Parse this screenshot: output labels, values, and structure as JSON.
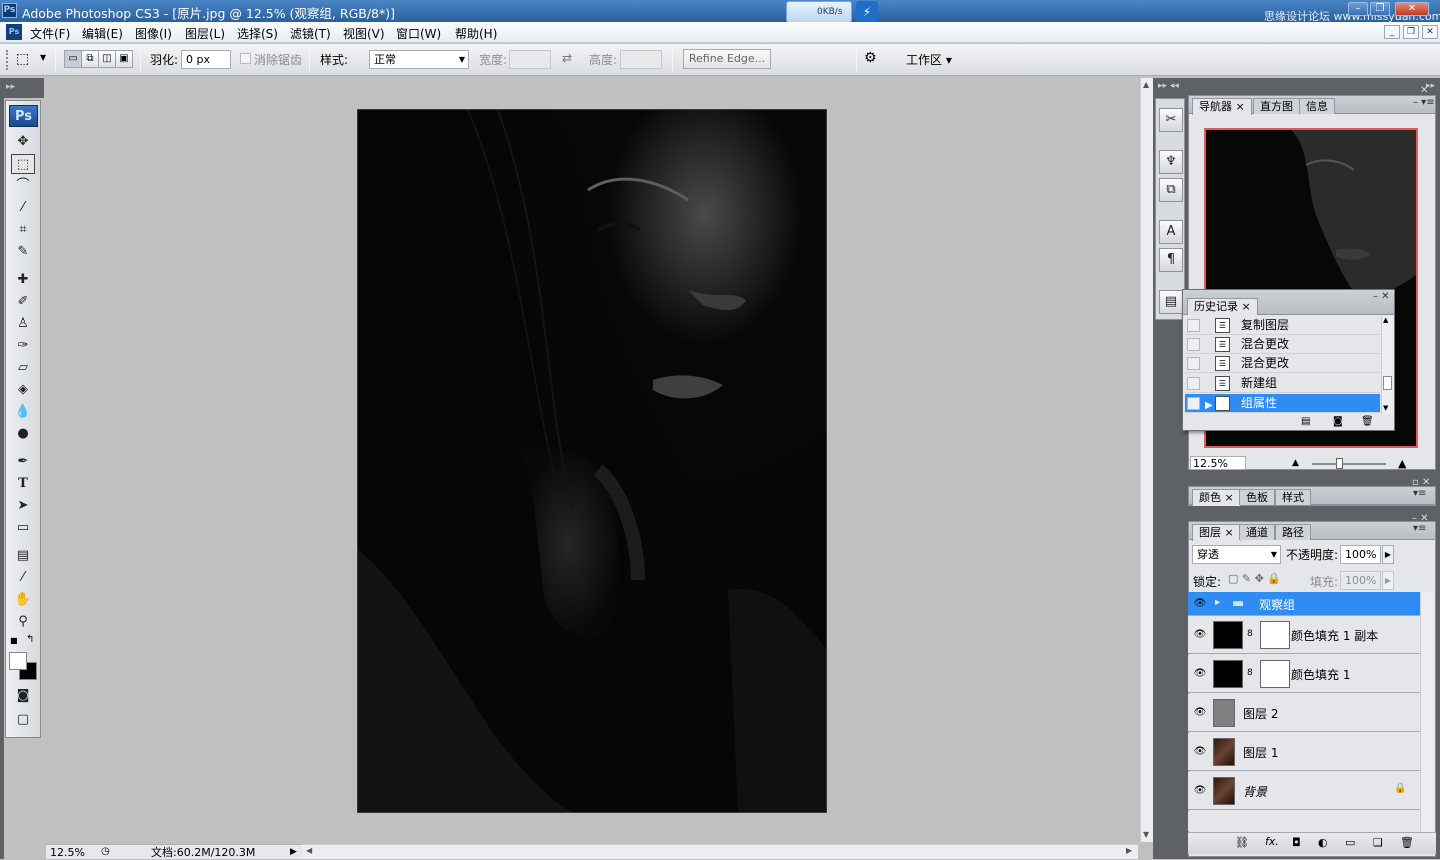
{
  "window": {
    "title": "Adobe Photoshop CS3 - [原片.jpg @ 12.5% (观察组, RGB/8*)]",
    "app_icon": "Ps",
    "speed": "0KB/s",
    "watermark": "思缘设计论坛 www.missyuan.com"
  },
  "menu": [
    "文件(F)",
    "编辑(E)",
    "图像(I)",
    "图层(L)",
    "选择(S)",
    "滤镜(T)",
    "视图(V)",
    "窗口(W)",
    "帮助(H)"
  ],
  "options": {
    "feather_label": "羽化:",
    "feather_value": "0 px",
    "antialias_label": "消除锯齿",
    "style_label": "样式:",
    "style_value": "正常",
    "width_label": "宽度:",
    "height_label": "高度:",
    "refine_edge": "Refine Edge...",
    "workspace": "工作区 ▾"
  },
  "toolbox": {
    "logo": "Ps",
    "tools": [
      "move-tool",
      "marquee-tool",
      "lasso-tool",
      "magic-wand-tool",
      "crop-tool",
      "slice-tool",
      "healing-brush-tool",
      "brush-tool",
      "clone-stamp-tool",
      "history-brush-tool",
      "eraser-tool",
      "paint-bucket-tool",
      "blur-tool",
      "dodge-tool",
      "pen-tool",
      "type-tool",
      "path-selection-tool",
      "shape-tool",
      "notes-tool",
      "eyedropper-tool",
      "hand-tool",
      "zoom-tool"
    ]
  },
  "status": {
    "zoom": "12.5%",
    "doc": "文档:60.2M/120.3M"
  },
  "navigator": {
    "tabs": [
      "导航器",
      "直方图",
      "信息"
    ],
    "zoom": "12.5%"
  },
  "history": {
    "tab": "历史记录",
    "items": [
      {
        "label": "复制图层",
        "selected": false
      },
      {
        "label": "混合更改",
        "selected": false
      },
      {
        "label": "混合更改",
        "selected": false
      },
      {
        "label": "新建组",
        "selected": false
      },
      {
        "label": "组属性",
        "selected": true
      }
    ]
  },
  "color_panel": {
    "tabs": [
      "颜色",
      "色板",
      "样式"
    ]
  },
  "layers_panel": {
    "tabs": [
      "图层",
      "通道",
      "路径"
    ],
    "blend_mode": "穿透",
    "opacity_label": "不透明度:",
    "opacity": "100%",
    "lock_label": "锁定:",
    "fill_label": "填充:",
    "fill": "100%",
    "layers": [
      {
        "name": "观察组",
        "type": "group",
        "selected": true
      },
      {
        "name": "颜色填充 1 副本",
        "type": "fill"
      },
      {
        "name": "颜色填充 1",
        "type": "fill"
      },
      {
        "name": "图层 2",
        "type": "gray"
      },
      {
        "name": "图层 1",
        "type": "photo"
      },
      {
        "name": "背景",
        "type": "background"
      }
    ]
  },
  "colors": {
    "selection_blue": "#2f8cf2",
    "dock_dark": "#5e6166",
    "canvas_grey": "#c0c0c0"
  }
}
